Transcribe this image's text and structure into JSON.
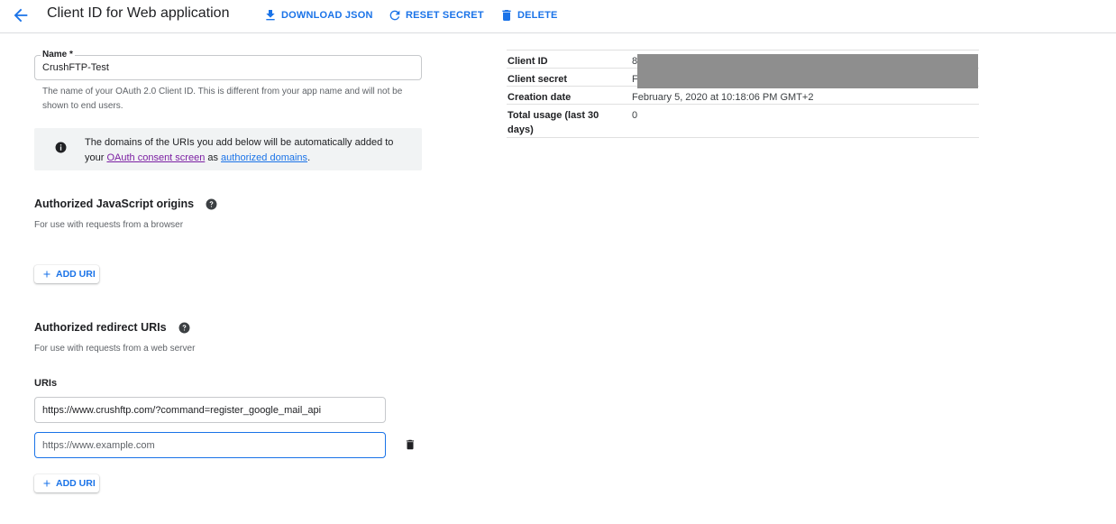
{
  "header": {
    "title": "Client ID for Web application",
    "download_label": "DOWNLOAD JSON",
    "reset_label": "RESET SECRET",
    "delete_label": "DELETE",
    "accent_color": "#1a73e8"
  },
  "name_field": {
    "label": "Name *",
    "value": "CrushFTP-Test",
    "help": "The name of your OAuth 2.0 Client ID. This is different from your app name and will not be shown to end users."
  },
  "info": {
    "text_before": "The domains of the URIs you add below will be automatically added to your ",
    "link1": "OAuth consent screen",
    "text_mid": " as ",
    "link2": "authorized domains",
    "text_after": "."
  },
  "js_origins": {
    "title": "Authorized JavaScript origins",
    "subtitle": "For use with requests from a browser",
    "add_label": "ADD URI"
  },
  "redirect_uris": {
    "title": "Authorized redirect URIs",
    "subtitle": "For use with requests from a web server",
    "uris_label": "URIs",
    "uri1_value": "https://www.crushftp.com/?command=register_google_mail_api",
    "uri2_placeholder": "https://www.example.com",
    "add_label": "ADD URI"
  },
  "meta": {
    "rows": [
      {
        "key": "Client ID",
        "value": "8"
      },
      {
        "key": "Client secret",
        "value": "F"
      },
      {
        "key": "Creation date",
        "value": "February 5, 2020 at 10:18:06 PM GMT+2"
      },
      {
        "key": "Total usage (last 30 days)",
        "value": "0"
      }
    ]
  },
  "icons": [
    "back-arrow-icon",
    "download-icon",
    "refresh-icon",
    "trash-icon",
    "info-icon",
    "help-icon",
    "plus-icon"
  ]
}
